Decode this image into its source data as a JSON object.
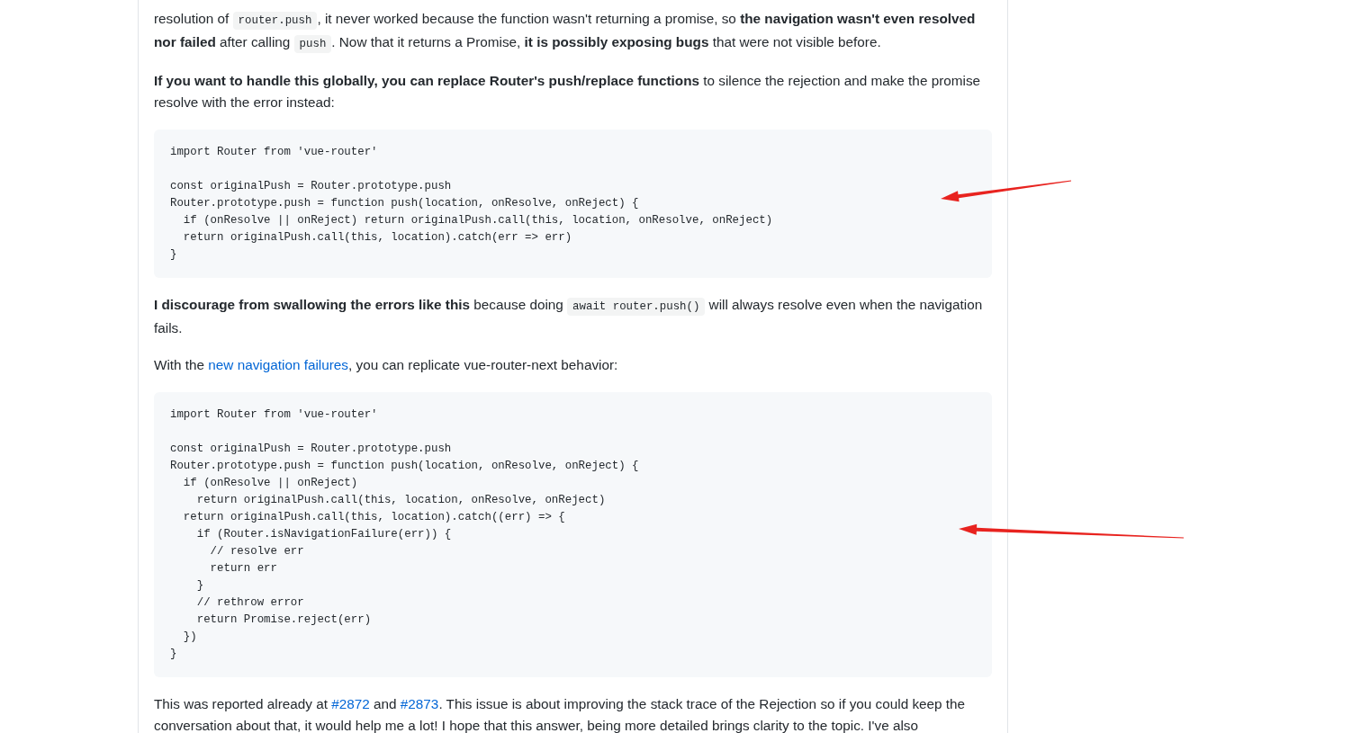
{
  "paragraphs_before": [
    {
      "segments": [
        {
          "kind": "text",
          "text": "resolution of "
        },
        {
          "kind": "code",
          "text": "router.push"
        },
        {
          "kind": "text",
          "text": ", it never worked because the function wasn't returning a promise, so **the navigation wasn't even resolved nor failed** after calling "
        },
        {
          "kind": "code",
          "text": "push"
        },
        {
          "kind": "text",
          "text": ". Now that it returns a Promise, **it is possibly exposing bugs** that were not visible before."
        }
      ]
    },
    {
      "segments": [
        {
          "kind": "text",
          "text": "**If you want to handle this globally, you can replace Router's push/replace functions** to silence the rejection and make the promise resolve with the error instead:"
        }
      ]
    }
  ],
  "code_block_1": [
    [
      "import Router from 'vue-router'"
    ],
    [
      "const originalPush = Router.prototype.push",
      "Router.prototype.push = function push(location, onResolve, onReject) {",
      "  if (onResolve || onReject) return originalPush.call(this, location, onResolve, onReject)",
      "  return originalPush.call(this, location).catch(err => err)",
      "}"
    ]
  ],
  "paragraphs_middle": [
    {
      "segments": [
        {
          "kind": "text",
          "text": "**I discourage from swallowing the errors like this** because doing "
        },
        {
          "kind": "code",
          "text": "await router.push()"
        },
        {
          "kind": "text",
          "text": " will always resolve even when the navigation fails."
        }
      ]
    },
    {
      "segments": [
        {
          "kind": "text",
          "text": "With the "
        },
        {
          "kind": "link",
          "text": "new navigation failures"
        },
        {
          "kind": "text",
          "text": ", you can replicate vue-router-next behavior:"
        }
      ]
    }
  ],
  "code_block_2": [
    [
      "import Router from 'vue-router'"
    ],
    [
      "const originalPush = Router.prototype.push",
      "Router.prototype.push = function push(location, onResolve, onReject) {",
      "  if (onResolve || onReject)",
      "    return originalPush.call(this, location, onResolve, onReject)",
      "  return originalPush.call(this, location).catch((err) => {",
      "    if (Router.isNavigationFailure(err)) {",
      "      // resolve err",
      "      return err",
      "    }",
      "    // rethrow error",
      "    return Promise.reject(err)",
      "  })",
      "}"
    ]
  ],
  "paragraphs_after": [
    {
      "segments": [
        {
          "kind": "text",
          "text": "This was reported already at "
        },
        {
          "kind": "link",
          "text": "#2872"
        },
        {
          "kind": "text",
          "text": " and "
        },
        {
          "kind": "link",
          "text": "#2873"
        },
        {
          "kind": "text",
          "text": ". This issue is about improving the stack trace of the Rejection so if you could keep the conversation about that, it would help me a lot! I hope that this answer, being more detailed brings clarity to the topic. I've also"
        }
      ]
    }
  ],
  "annotations": [
    {
      "kind": "arrow"
    },
    {
      "kind": "arrow"
    }
  ]
}
